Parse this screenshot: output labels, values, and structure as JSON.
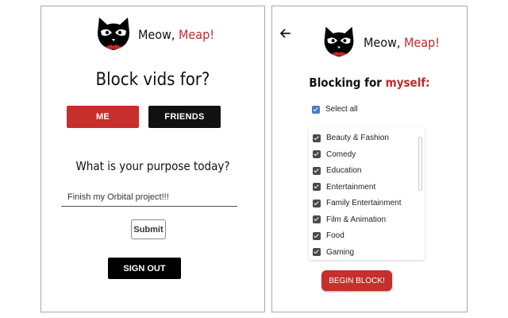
{
  "brand": {
    "name_part1": "Meow, ",
    "name_part2": "Meap!",
    "accent_color": "#c0282b"
  },
  "left_panel": {
    "heading": "Block vids for?",
    "options": [
      {
        "label": "ME",
        "color": "#c62f2b"
      },
      {
        "label": "FRIENDS",
        "color": "#111111"
      }
    ],
    "purpose_heading": "What is your purpose today?",
    "purpose_input_value": "Finish my Orbital project!!!",
    "submit_label": "Submit",
    "signout_label": "SIGN OUT"
  },
  "right_panel": {
    "back_icon": "arrow-left-icon",
    "heading_prefix": "Blocking for ",
    "heading_accent": "myself:",
    "select_all_label": "Select all",
    "select_all_checked": true,
    "categories": [
      {
        "label": "Beauty & Fashion",
        "checked": true
      },
      {
        "label": "Comedy",
        "checked": true
      },
      {
        "label": "Education",
        "checked": true
      },
      {
        "label": "Entertainment",
        "checked": true
      },
      {
        "label": "Family Entertainment",
        "checked": true
      },
      {
        "label": "Film & Animation",
        "checked": true
      },
      {
        "label": "Food",
        "checked": true
      },
      {
        "label": "Gaming",
        "checked": true
      }
    ],
    "begin_label": "BEGIN BLOCK!"
  }
}
